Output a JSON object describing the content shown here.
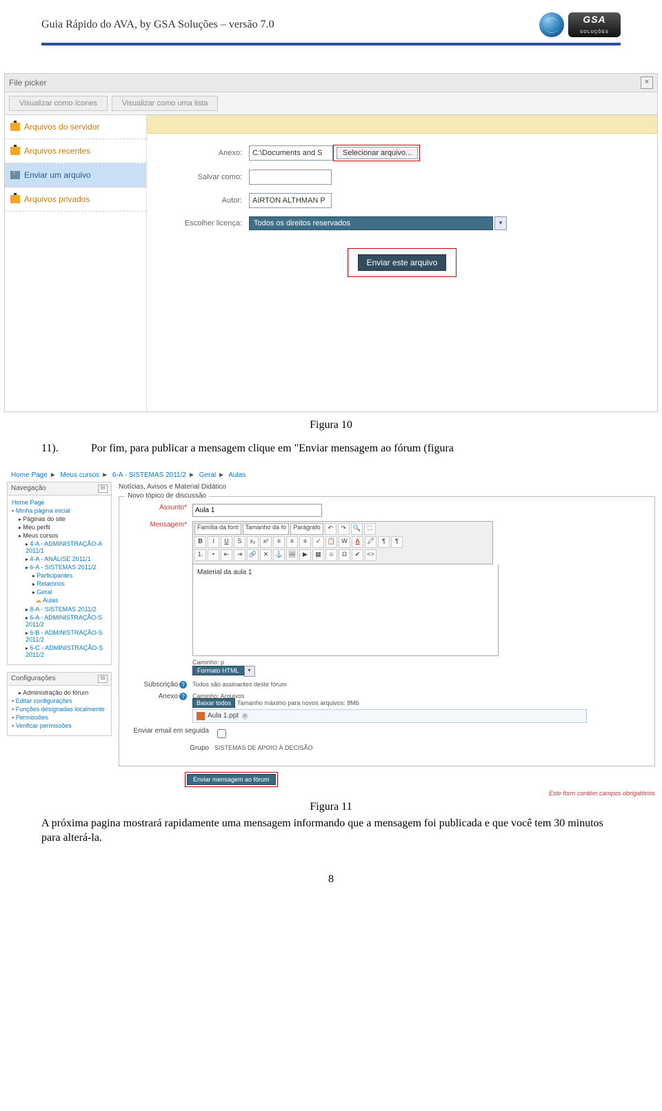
{
  "header": {
    "title": "Guia Rápido do AVA, by GSA Soluções – versão 7.0"
  },
  "filepicker": {
    "title": "File picker",
    "close": "×",
    "tabs": {
      "icons": "Visualizar como ícones",
      "list": "Visualizar como uma lista"
    },
    "side": {
      "server": "Arquivos do servidor",
      "recent": "Arquivos recentes",
      "upload": "Enviar um arquivo",
      "private": "Arquivos privados"
    },
    "form": {
      "anexo_label": "Anexo:",
      "anexo_value": "C:\\Documents and S",
      "select_btn": "Selecionar arquivo...",
      "saveas_label": "Salvar como:",
      "saveas_value": "",
      "author_label": "Autor:",
      "author_value": "AIRTON ALTHMAN P",
      "license_label": "Escolher licença:",
      "license_value": "Todos os direitos reservados",
      "submit": "Enviar este arquivo"
    }
  },
  "caption1": "Figura 10",
  "para1_num": "11).",
  "para1_text": "Por fim, para publicar a mensagem clique em \"Enviar mensagem ao fórum (figura",
  "forum": {
    "breadcrumbs": [
      "Home Page",
      "Meus cursos",
      "6-A - SISTEMAS 2011/2",
      "Geral",
      "Aulas"
    ],
    "navbox_title": "Navegação",
    "nav": {
      "home": "Home Page",
      "myhome": "Minha página inicial",
      "sitepages": "Páginas do site",
      "myprofile": "Meu perfil",
      "mycourses": "Meus cursos",
      "c1": "4-A - ADMINISTRAÇÃO-A 2011/1",
      "c2": "4-A - ANÁLISE 2011/1",
      "c3": "6-A - SISTEMAS 2011/2",
      "participants": "Participantes",
      "reports": "Relatórios",
      "general": "Geral",
      "aulas": "Aulas",
      "c4": "8-A - SISTEMAS 2011/2",
      "c5": "6-A - ADMINISTRAÇÃO-S 2011/2",
      "c6": "6-B - ADMINISTRAÇÃO-S 2011/2",
      "c7": "6-C - ADMINISTRAÇÃO-S 2011/2"
    },
    "cfgbox_title": "Configurações",
    "cfg": {
      "admin": "Administração do fórum",
      "edit": "Editar configurações",
      "roles": "Funções designadas localmente",
      "perms": "Permissões",
      "verify": "Verificar permissões"
    },
    "notices": "Notícias, Avisos e Material Didático",
    "legend": "Novo tópico de discussão",
    "subject_label": "Assunto*",
    "subject_value": "Aula 1",
    "message_label": "Mensagem*",
    "toolbar": {
      "font": "Família da font",
      "size": "Tamanho da fo",
      "format": "Parágrafo"
    },
    "editor_content": "Material da aula 1",
    "path": "Caminho: p",
    "format_btn": "Formato HTML",
    "subscribe_label": "Subscrição",
    "subscribe_text": "Todos são assinantes deste fórum",
    "attach_label": "Anexo",
    "attach_path": "Caminho: Arquivos",
    "download_btn": "Baixar todos",
    "attach_hint": "Tamanho máximo para novos arquivos: 8Mb",
    "attach_file": "Aula 1.ppt",
    "email_label": "Enviar email em seguida",
    "group_label": "Grupo",
    "group_value": "SISTEMAS DE APOIO À DECISÃO",
    "submit": "Enviar mensagem ao fórum",
    "required_note": "Este form contém campos obrigatórios"
  },
  "caption2": "Figura 11",
  "body_text": "A próxima pagina mostrará rapidamente uma mensagem informando que a mensagem foi publicada e que você tem 30 minutos para alterá-la.",
  "pagenum": "8"
}
